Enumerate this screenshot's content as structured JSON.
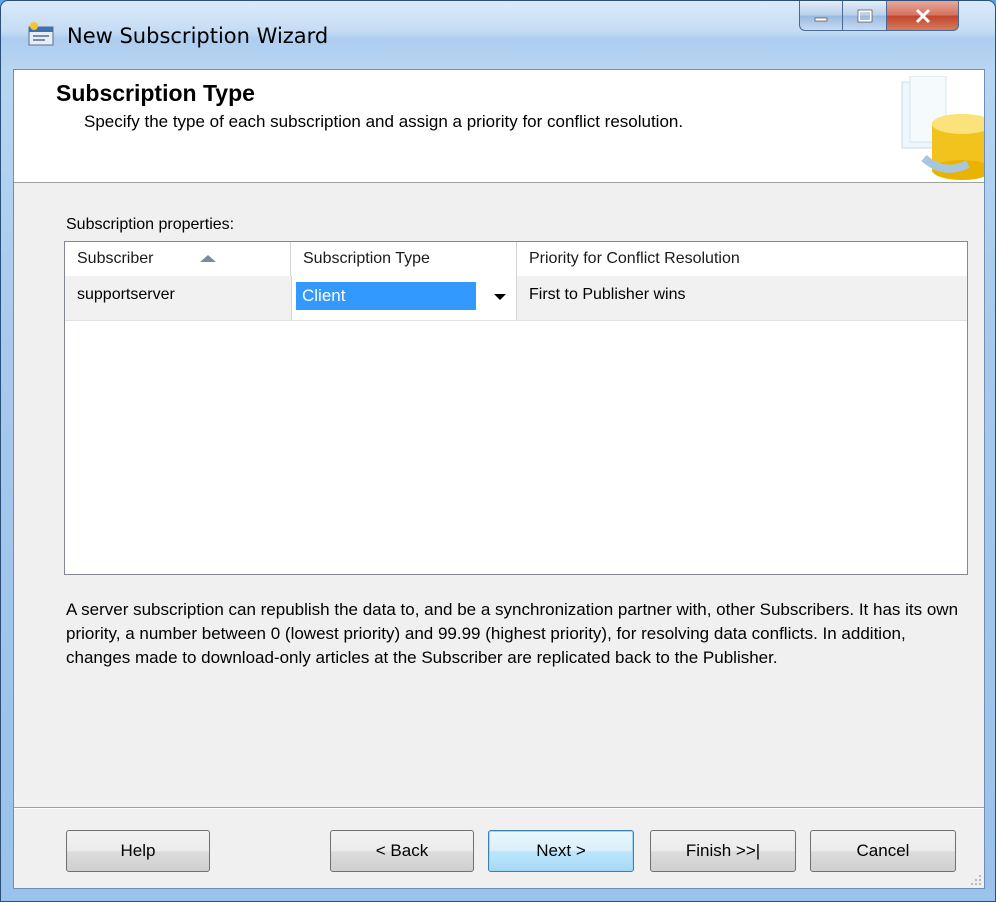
{
  "window": {
    "title": "New Subscription Wizard",
    "icon": "wizard-app-icon",
    "controls": [
      "minimize",
      "maximize",
      "close"
    ]
  },
  "header": {
    "title": "Subscription Type",
    "subtitle": "Specify the type of each subscription and assign a priority for conflict resolution."
  },
  "grid": {
    "label": "Subscription properties:",
    "columns": [
      "Subscriber",
      "Subscription Type",
      "Priority for Conflict Resolution"
    ],
    "rows": [
      {
        "subscriber": "supportserver",
        "type": "Client",
        "priority": "First to Publisher wins"
      }
    ]
  },
  "description": "A server subscription can republish the data to, and be a synchronization partner with, other Subscribers. It has its own priority, a number between 0 (lowest priority) and 99.99 (highest priority), for resolving data conflicts. In addition, changes made to download-only articles at the Subscriber are replicated back to the Publisher.",
  "buttons": {
    "help": "Help",
    "back": "< Back",
    "next": "Next >",
    "finish": "Finish >>|",
    "cancel": "Cancel"
  }
}
